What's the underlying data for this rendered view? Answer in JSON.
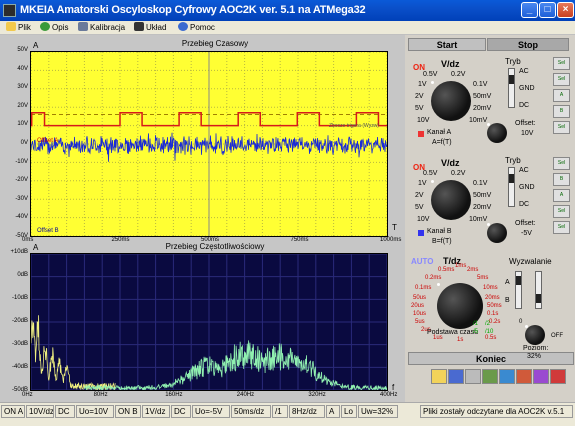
{
  "window": {
    "title": "MKEIA Amatorski Oscyloskop Cyfrowy AOC2K ver. 5.1 na ATMega32",
    "controls": {
      "minimize": "_",
      "maximize": "□",
      "close": "×"
    }
  },
  "menu": [
    {
      "label": "Plik",
      "icon": "file-icon"
    },
    {
      "label": "Opis",
      "icon": "globe-icon"
    },
    {
      "label": "Kalibracja",
      "icon": "calibration-icon"
    },
    {
      "label": "Układ",
      "icon": "circuit-icon"
    },
    {
      "label": "Pomoc",
      "icon": "help-icon"
    }
  ],
  "time_plot": {
    "title": "Przebieg Czasowy",
    "corner_left": "A",
    "corner_right": "T",
    "y_ticks": [
      "50V",
      "40V",
      "30V",
      "20V",
      "10V",
      "0V",
      "-10V",
      "-20V",
      "-30V",
      "-40V",
      "-50V"
    ],
    "x_ticks": [
      "0ms",
      "250ms",
      "500ms",
      "750ms",
      "1000ms"
    ],
    "offset_a": "Offset A",
    "offset_b": "Offset B",
    "trigger_note": "Zbocze trigera (Wyzw)",
    "colors": {
      "background": "#ffff33",
      "channel_a": "#d61a1a",
      "channel_b": "#1a2ad6"
    }
  },
  "freq_plot": {
    "title": "Przebieg Częstotliwościowy",
    "corner_left": "A",
    "corner_right": "f",
    "y_ticks": [
      "+10dB",
      "0dB",
      "-10dB",
      "-20dB",
      "-30dB",
      "-40dB",
      "-50dB"
    ],
    "x_ticks": [
      "0Hz",
      "80Hz",
      "160Hz",
      "240Hz",
      "320Hz",
      "400Hz"
    ],
    "colors": {
      "background": "#0a0a40",
      "channel_a": "#f0f080",
      "channel_b": "#90f0b0"
    }
  },
  "panel": {
    "start": "Start",
    "stop": "Stop",
    "channel_a": {
      "on": "ON",
      "vdz": "V/dz",
      "tryb": "Tryb",
      "scale_labels": [
        "0.5V",
        "0.2V",
        "1V",
        "0.1V",
        "2V",
        "50mV",
        "5V",
        "20mV",
        "10V",
        "10mV"
      ],
      "modes": [
        "AC",
        "GND",
        "DC"
      ],
      "name": "Kanał A",
      "formula": "A=f(T)",
      "offset_label": "Offset:",
      "offset_value": "10V"
    },
    "channel_b": {
      "on": "ON",
      "vdz": "V/dz",
      "tryb": "Tryb",
      "scale_labels": [
        "0.5V",
        "0.2V",
        "1V",
        "0.1V",
        "2V",
        "50mV",
        "5V",
        "20mV",
        "10V",
        "10mV"
      ],
      "modes": [
        "AC",
        "GND",
        "DC"
      ],
      "name": "Kanał B",
      "formula": "B=f(T)",
      "offset_label": "Offset:",
      "offset_value": "-5V"
    },
    "timebase": {
      "auto": "AUTO",
      "tdz": "T/dz",
      "scale_labels": [
        "0.5ms",
        "1ms",
        "2ms",
        "0.2ms",
        "5ms",
        "0.1ms",
        "10ms",
        "50us",
        "20ms",
        "20us",
        "50ms",
        "10us",
        "0.1s",
        "5us",
        "0.2s",
        "2us",
        "0.5s",
        "1us",
        "1s"
      ],
      "footer": "Podstawa czasu",
      "multipliers": [
        "/1",
        "/2",
        "/5",
        "/10"
      ]
    },
    "trigger": {
      "label": "Wyzwalanie",
      "sources": [
        "A",
        "B"
      ],
      "level_label": "Poziom:",
      "level_value": "32%",
      "min": "0",
      "max": "OFF"
    },
    "side_buttons": [
      "Sel",
      "Sel",
      "A",
      "B",
      "Sel",
      "Sel",
      "B",
      "A",
      "Sel",
      "Sel"
    ],
    "koniec": "Koniec",
    "toolbar_icons": [
      "folder-icon",
      "save-icon",
      "print-icon",
      "tools-icon",
      "export-icon",
      "chart-icon",
      "image-icon",
      "settings-icon"
    ]
  },
  "status": {
    "cells": [
      "ON A",
      "10V/dz",
      "DC",
      "Uo=10V",
      "ON B",
      "1V/dz",
      "DC",
      "Uo=-5V",
      "50ms/dz",
      "/1",
      "8Hz/dz",
      "A",
      "Lo",
      "Uw=32%"
    ],
    "message": "Pliki zostały odczytane dla AOC2K v.5.1"
  },
  "chart_data": [
    {
      "type": "line",
      "title": "Przebieg Czasowy",
      "x_unit": "ms",
      "xlim": [
        0,
        1000
      ],
      "ylim": [
        -50,
        50
      ],
      "y_unit": "V",
      "series": [
        {
          "name": "Offset A",
          "style": "square-wave",
          "low": 10,
          "high": 17,
          "period_ms": 166,
          "pulse_ms": 62
        },
        {
          "name": "Offset B",
          "style": "noise",
          "center": -0.5,
          "amplitude": 4
        }
      ],
      "grid": true
    },
    {
      "type": "line",
      "title": "Przebieg Częstotliwościowy",
      "x_unit": "Hz",
      "xlim": [
        0,
        400
      ],
      "ylim": [
        -50,
        10
      ],
      "y_unit": "dB",
      "series": [
        {
          "name": "A",
          "peaks_hz": [
            2,
            8,
            16,
            24,
            32,
            40
          ],
          "peak_db": [
            -15,
            -20,
            -28,
            -33,
            -37,
            -40
          ]
        },
        {
          "name": "B",
          "peaks_hz": [
            200,
            240,
            280,
            300
          ],
          "peak_db": [
            -37,
            -30,
            -31,
            -36
          ]
        }
      ],
      "grid": true
    }
  ]
}
